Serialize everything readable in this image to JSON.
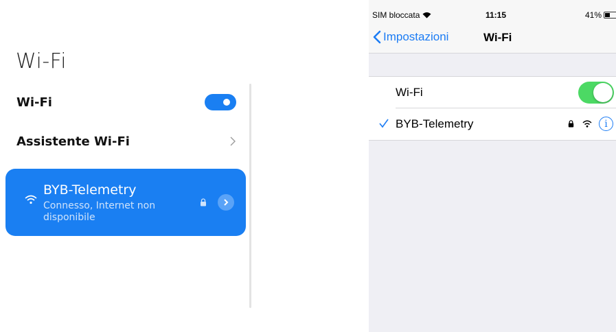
{
  "android": {
    "title": "Wi-Fi",
    "wifi_label": "Wi-Fi",
    "wifi_enabled": true,
    "assistant_label": "Assistente Wi-Fi",
    "connected_network": {
      "ssid": "BYB-Telemetry",
      "status": "Connesso, Internet non disponibile",
      "secured": true
    },
    "colors": {
      "accent": "#1a7ff2",
      "card_bg": "#1a7ff2"
    },
    "icons": [
      "wifi-icon",
      "lock-icon",
      "chevron-right-icon"
    ]
  },
  "ios": {
    "status_bar": {
      "carrier": "SIM bloccata",
      "time": "11:15",
      "battery": "41%"
    },
    "nav": {
      "back_label": "Impostazioni",
      "title": "Wi-Fi"
    },
    "wifi_label": "Wi-Fi",
    "wifi_enabled": true,
    "connected_network": {
      "ssid": "BYB-Telemetry",
      "secured": true,
      "info_glyph": "i"
    },
    "colors": {
      "accent": "#1c7cf4",
      "switch_on": "#4cd964"
    }
  }
}
